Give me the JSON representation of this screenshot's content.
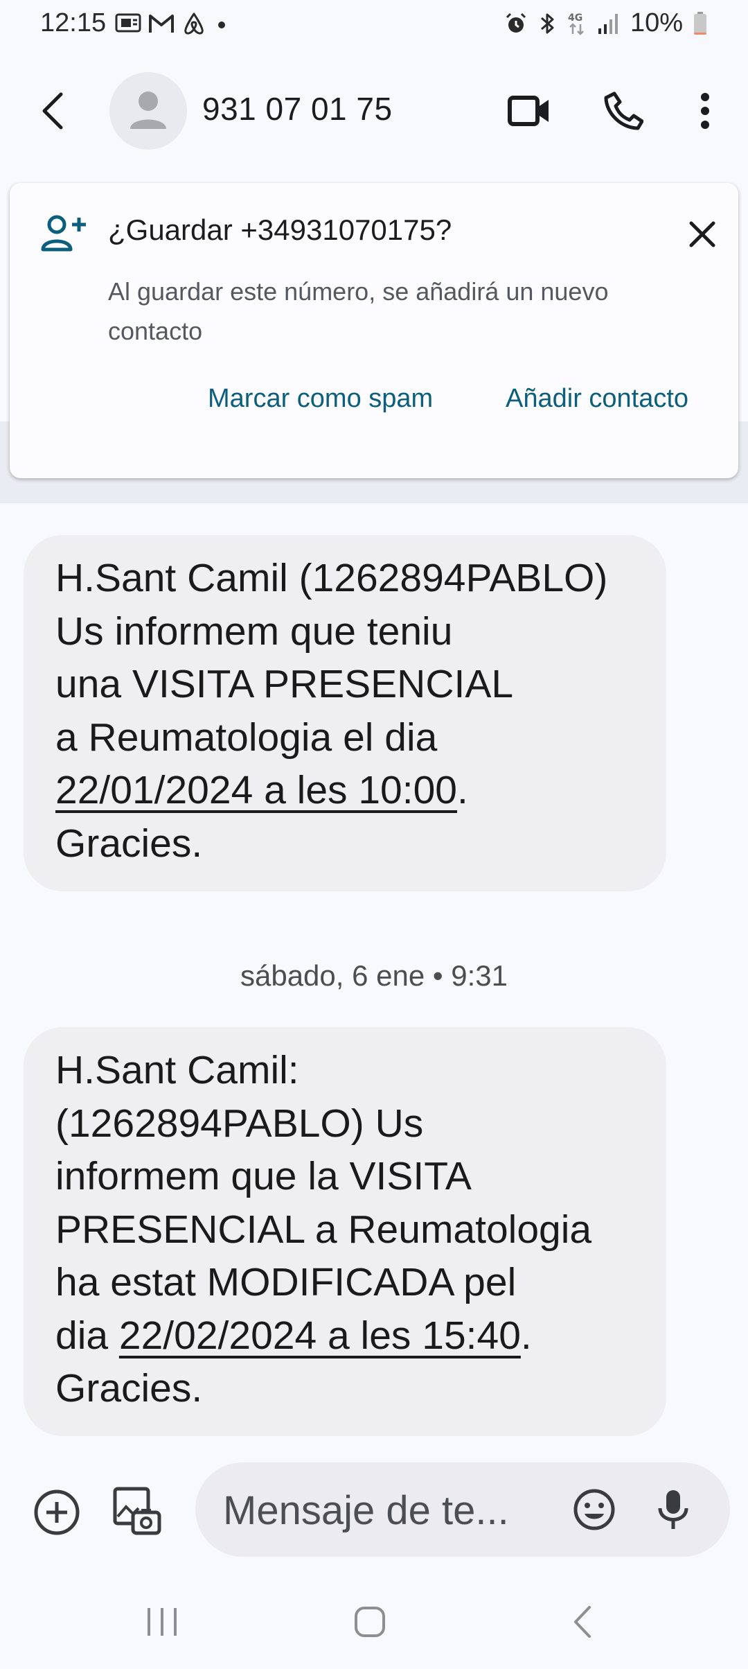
{
  "status_bar": {
    "time": "12:15",
    "left_icons": [
      "cast-icon",
      "gmail-icon",
      "airbnb-icon",
      "dot-icon"
    ],
    "right_icons": [
      "alarm-icon",
      "bluetooth-icon",
      "4g-icon",
      "signal-icon"
    ],
    "battery_percent": "10%",
    "battery_level": 0.1,
    "battery_color": "#f08a6b"
  },
  "app_bar": {
    "contact": "931 07 01 75",
    "icons": [
      "back-arrow-icon",
      "person-icon",
      "video-call-icon",
      "phone-icon",
      "more-vert-icon"
    ]
  },
  "save_card": {
    "title": "¿Guardar +34931070175?",
    "body": "Al guardar este número, se añadirá un nuevo contacto",
    "spam_button": "Marcar como spam",
    "add_button": "Añadir contacto",
    "accent": "#0b5f7d"
  },
  "messages": [
    {
      "lines": [
        [
          "H.Sant Camil (1262894PABLO)"
        ],
        [
          "Us informem que teniu"
        ],
        [
          "una VISITA PRESENCIAL"
        ],
        [
          "a Reumatologia el dia"
        ],
        [
          "",
          "22/01/2024 a les 10:00",
          "."
        ],
        [
          "Gracies."
        ]
      ]
    },
    {
      "lines": [
        [
          "H.Sant Camil:"
        ],
        [
          "(1262894PABLO) Us"
        ],
        [
          "informem que la VISITA"
        ],
        [
          "PRESENCIAL a Reumatologia"
        ],
        [
          "ha estat MODIFICADA pel"
        ],
        [
          "dia ",
          "22/02/2024 a les 15:40",
          "."
        ],
        [
          "Gracies."
        ]
      ]
    }
  ],
  "date_separator": "sábado, 6 ene • 9:31",
  "composer": {
    "placeholder": "Mensaje de te...",
    "icons": [
      "add-circle-icon",
      "gallery-icon",
      "emoji-icon",
      "mic-icon"
    ]
  },
  "nav_bar": {
    "icons": [
      "recent-apps-icon",
      "home-icon",
      "back-icon"
    ]
  }
}
